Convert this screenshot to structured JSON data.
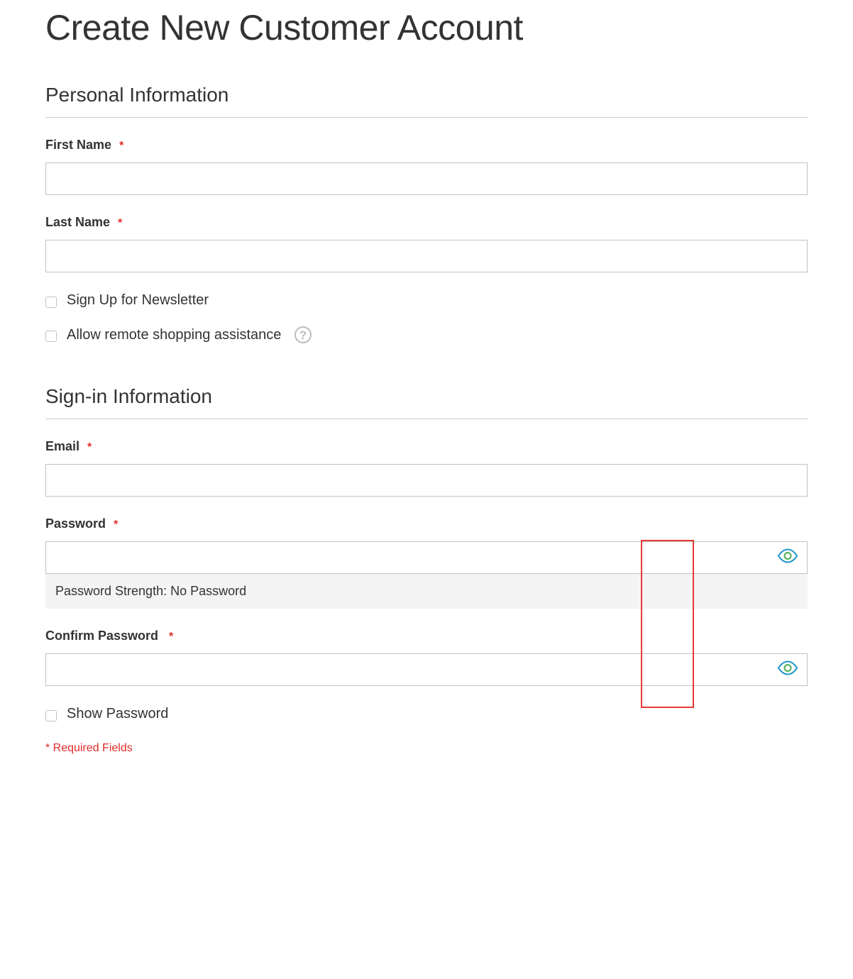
{
  "page": {
    "title": "Create New Customer Account"
  },
  "sections": {
    "personal": {
      "title": "Personal Information",
      "first_name_label": "First Name",
      "first_name_value": "",
      "last_name_label": "Last Name",
      "last_name_value": "",
      "newsletter_label": "Sign Up for Newsletter",
      "remote_assist_label": "Allow remote shopping assistance"
    },
    "signin": {
      "title": "Sign-in Information",
      "email_label": "Email",
      "email_value": "",
      "password_label": "Password",
      "password_value": "",
      "password_strength_label": "Password Strength: ",
      "password_strength_value": "No Password",
      "confirm_password_label": "Confirm Password",
      "confirm_password_value": "",
      "show_password_label": "Show Password"
    }
  },
  "footer": {
    "required_note": "* Required Fields"
  },
  "required_mark": "*"
}
